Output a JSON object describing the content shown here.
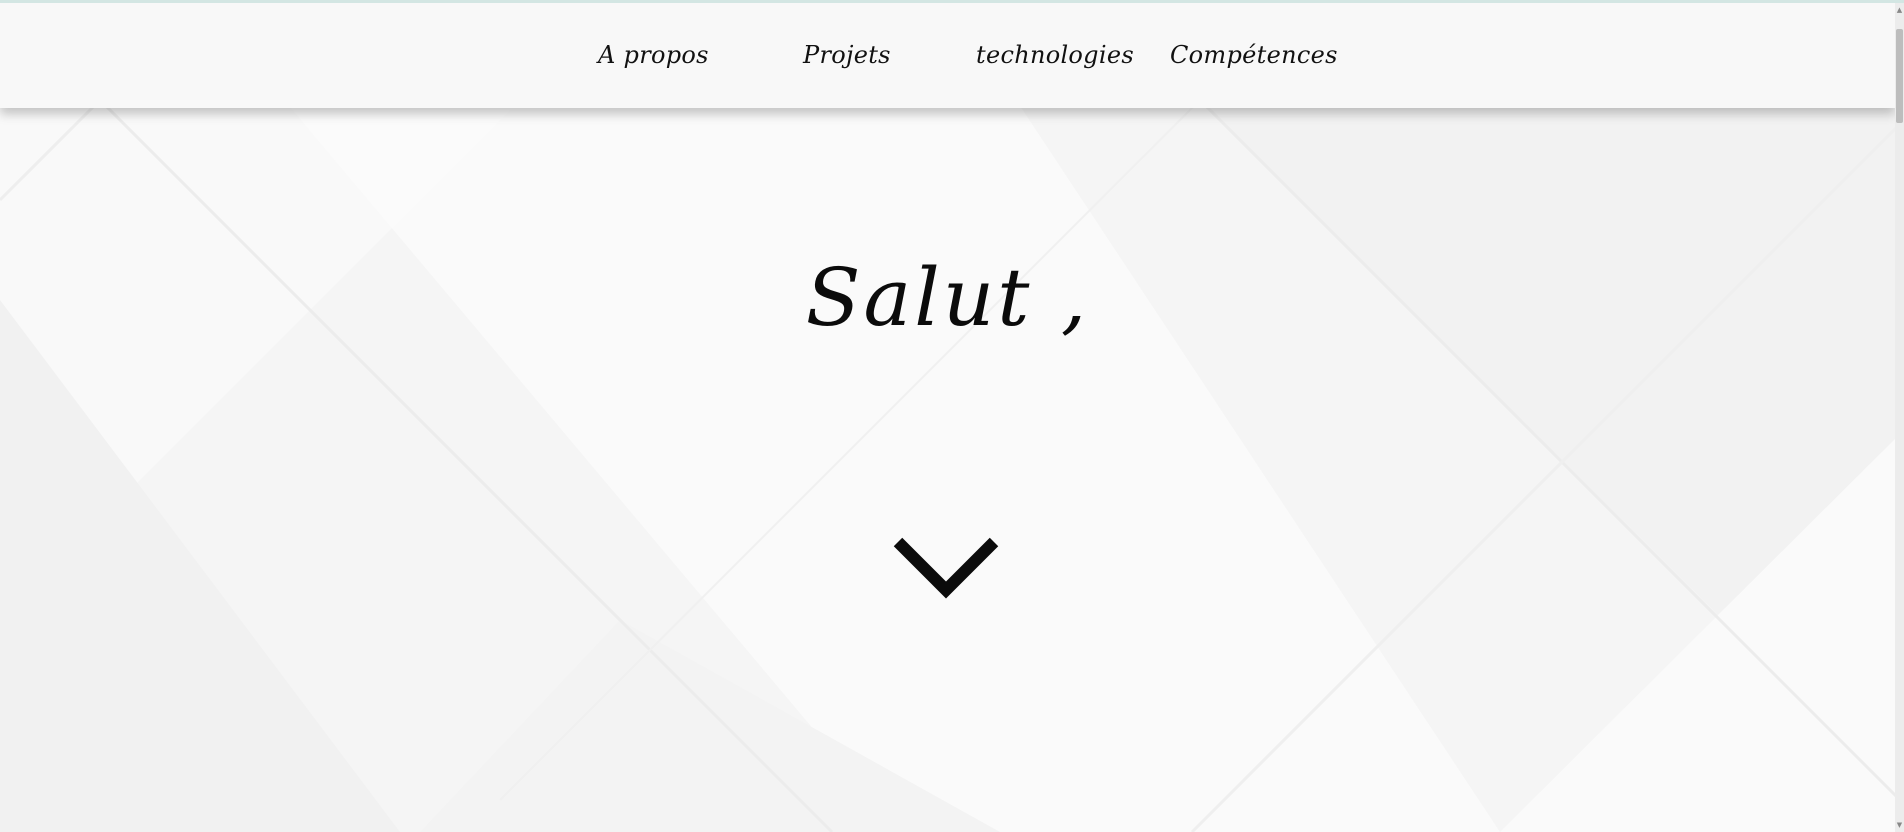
{
  "nav": {
    "items": [
      {
        "label": "A propos"
      },
      {
        "label": "Projets"
      },
      {
        "label": "technologies"
      },
      {
        "label": "Compétences"
      }
    ]
  },
  "hero": {
    "title": "Salut ,"
  },
  "icons": {
    "scroll_down": "chevron-down-icon",
    "scrollbar_up": "arrow-up-icon",
    "scrollbar_down": "arrow-down-icon"
  },
  "colors": {
    "background": "#f6f6f6",
    "navbar": "#f8f8f8",
    "text": "#111111",
    "top_border": "#d3e6e3"
  }
}
